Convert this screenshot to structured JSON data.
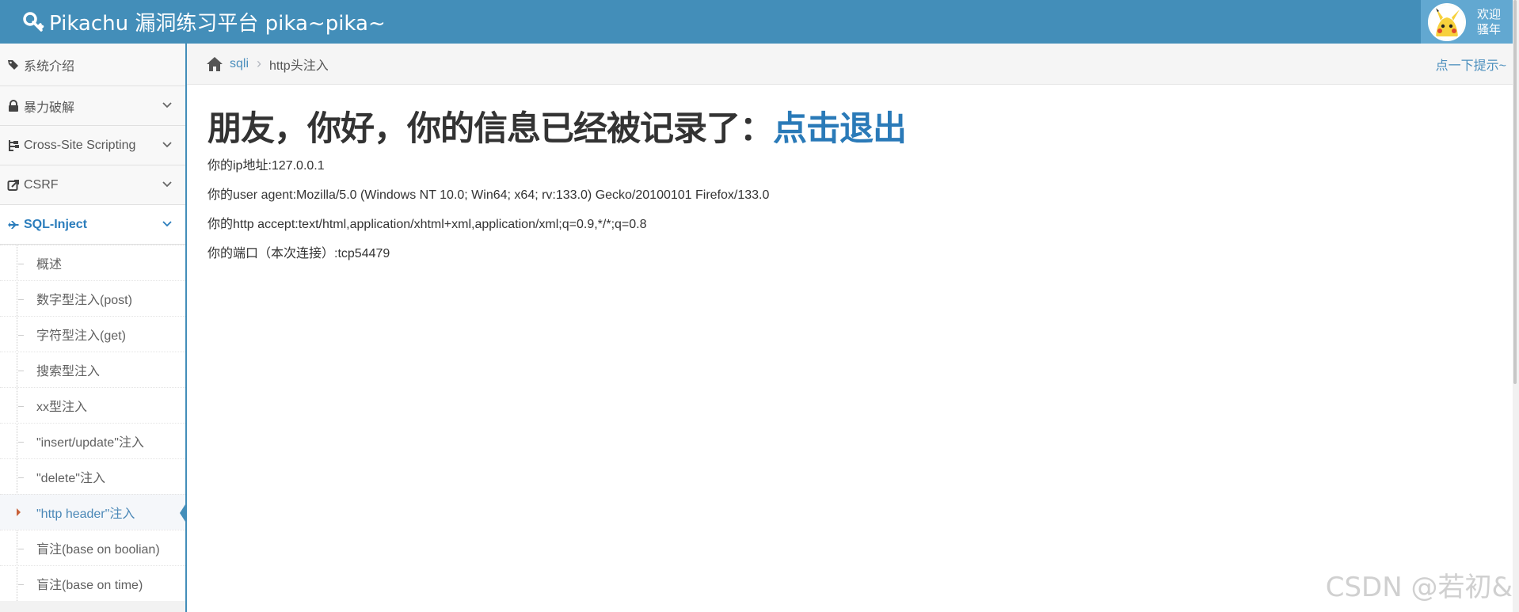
{
  "navbar": {
    "brand": "Pikachu 漏洞练习平台 pika~pika~",
    "user_line1": "欢迎",
    "user_line2": "骚年"
  },
  "sidebar": {
    "items": [
      {
        "label": "系统介绍",
        "icon": "tags-icon"
      },
      {
        "label": "暴力破解",
        "icon": "lock-icon"
      },
      {
        "label": "Cross-Site Scripting",
        "icon": "sitemap-icon"
      },
      {
        "label": "CSRF",
        "icon": "share-icon"
      },
      {
        "label": "SQL-Inject",
        "icon": "fighter-jet-icon"
      }
    ],
    "submenu": [
      "概述",
      "数字型注入(post)",
      "字符型注入(get)",
      "搜索型注入",
      "xx型注入",
      "\"insert/update\"注入",
      "\"delete\"注入",
      "\"http header\"注入",
      "盲注(base on boolian)",
      "盲注(base on time)"
    ]
  },
  "breadcrumb": {
    "link": "sqli",
    "current": "http头注入",
    "hint": "点一下提示~"
  },
  "main": {
    "headline": "朋友，你好，你的信息已经被记录了：",
    "logout": "点击退出",
    "ip": "你的ip地址:127.0.0.1",
    "user_agent": "你的user agent:Mozilla/5.0 (Windows NT 10.0; Win64; x64; rv:133.0) Gecko/20100101 Firefox/133.0",
    "accept": "你的http accept:text/html,application/xhtml+xml,application/xml;q=0.9,*/*;q=0.8",
    "port": "你的端口（本次连接）:tcp54479"
  },
  "watermark": "CSDN @若初&",
  "colors": {
    "navbar": "#438eb9",
    "link": "#2a7ab8",
    "active": "#2b7dbc"
  }
}
